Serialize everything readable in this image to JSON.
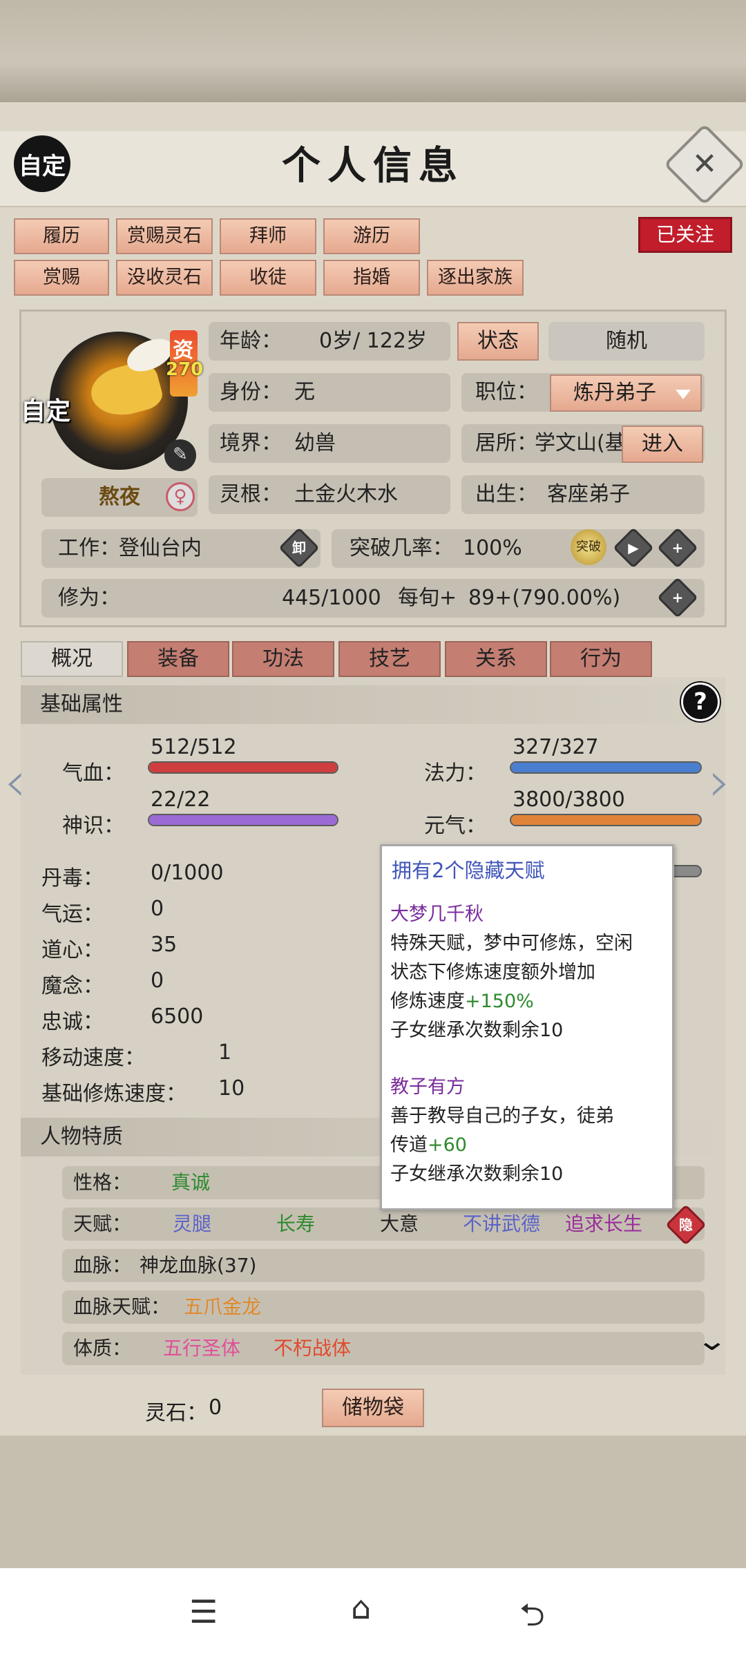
{
  "header": {
    "custom_badge": "自定",
    "title": "个人信息",
    "close_symbol": "✕"
  },
  "actions": {
    "row1": [
      "履历",
      "赏赐灵石",
      "拜师",
      "游历"
    ],
    "row2": [
      "赏赐",
      "没收灵石",
      "收徒",
      "指婚",
      "逐出家族"
    ],
    "follow": "已关注"
  },
  "profile": {
    "quality_char": "资",
    "quality_value": "270",
    "avatar_tag": "自定",
    "nickname": "熬夜",
    "gender_symbol": "♀",
    "age_label": "年龄：",
    "age_value": "0岁/ 122岁",
    "state_button": "状态",
    "random_button": "随机",
    "identity_label": "身份：",
    "identity_value": "无",
    "job_label": "职位：",
    "job_value": "炼丹弟子",
    "realm_label": "境界：",
    "realm_value": "幼兽",
    "residence_label": "居所：",
    "residence_value": "学文山(基",
    "enter_button": "进入",
    "root_label": "灵根：",
    "root_value": "土金火木水",
    "birth_label": "出生：",
    "birth_value": "客座弟子",
    "work_label": "工作：",
    "work_value": "登仙台内",
    "unload_icon": "卸",
    "break_label": "突破几率：",
    "break_value": "100%",
    "break_icon_text": "突破",
    "cult_label": "修为：",
    "cult_value": "445/1000",
    "cult_per_label": "每旬+",
    "cult_per_value": "89+(790.00%)"
  },
  "tabs": [
    "概况",
    "装备",
    "功法",
    "技艺",
    "关系",
    "行为"
  ],
  "basic": {
    "title": "基础属性",
    "help": "?",
    "hp_label": "气血：",
    "hp_value": "512/512",
    "hp_ratio": 1.0,
    "mana_label": "法力：",
    "mana_value": "327/327",
    "mana_ratio": 1.0,
    "sense_label": "神识：",
    "sense_value": "22/22",
    "sense_ratio": 1.0,
    "qi_label": "元气：",
    "qi_value": "3800/3800",
    "qi_ratio": 1.0,
    "rows": [
      {
        "label": "丹毒：",
        "value": "0/1000"
      },
      {
        "label": "气运：",
        "value": "0"
      },
      {
        "label": "道心：",
        "value": "35"
      },
      {
        "label": "魔念：",
        "value": "0"
      },
      {
        "label": "忠诚：",
        "value": "6500"
      },
      {
        "label": "移动速度：",
        "value": "1"
      },
      {
        "label": "基础修炼速度：",
        "value": "10"
      }
    ]
  },
  "traits": {
    "title": "人物特质",
    "personality_label": "性格：",
    "personality_value": "真诚",
    "talent_label": "天赋：",
    "talents": [
      "灵腿",
      "长寿",
      "大意",
      "不讲武德",
      "追求长生"
    ],
    "hidden_icon": "隐",
    "blood_label": "血脉：",
    "blood_value": "神龙血脉(37)",
    "blood_talent_label": "血脉天赋：",
    "blood_talent_value": "五爪金龙",
    "physique_label": "体质：",
    "physiques": [
      "五行圣体",
      "不朽战体"
    ]
  },
  "tooltip": {
    "title": "拥有2个隐藏天赋",
    "t1_name": "大梦几千秋",
    "t1_l1": "特殊天赋，梦中可修炼，空闲",
    "t1_l2": "状态下修炼速度额外增加",
    "t1_l3a": "修炼速度",
    "t1_l3b": "+150%",
    "t1_l4": "子女继承次数剩余10",
    "t2_name": "教子有方",
    "t2_l1": "善于教导自己的子女，徒弟",
    "t2_l2a": "传道",
    "t2_l2b": "+60",
    "t2_l3": "子女继承次数剩余10"
  },
  "footer": {
    "spirit_label": "灵石：",
    "spirit_value": "0",
    "bag_button": "储物袋"
  },
  "colors": {
    "hp": "#cf3e3e",
    "mana": "#4a7fd0",
    "sense": "#9c6ad4",
    "qi": "#e0843a",
    "talent_blue": "#5b63c7",
    "talent_green": "#2e8a2e",
    "talent_purple": "#9b2d9b",
    "blood_orange": "#e08a2c",
    "physique_pink": "#e0509a",
    "physique_red": "#e04a2c"
  },
  "icons": [
    "close-icon",
    "pencil-icon",
    "female-icon",
    "unload-icon",
    "play-icon",
    "plus-icon",
    "help-icon",
    "chevron-left-icon",
    "chevron-right-icon",
    "chevron-down-icon",
    "menu-icon",
    "home-icon",
    "back-icon"
  ]
}
